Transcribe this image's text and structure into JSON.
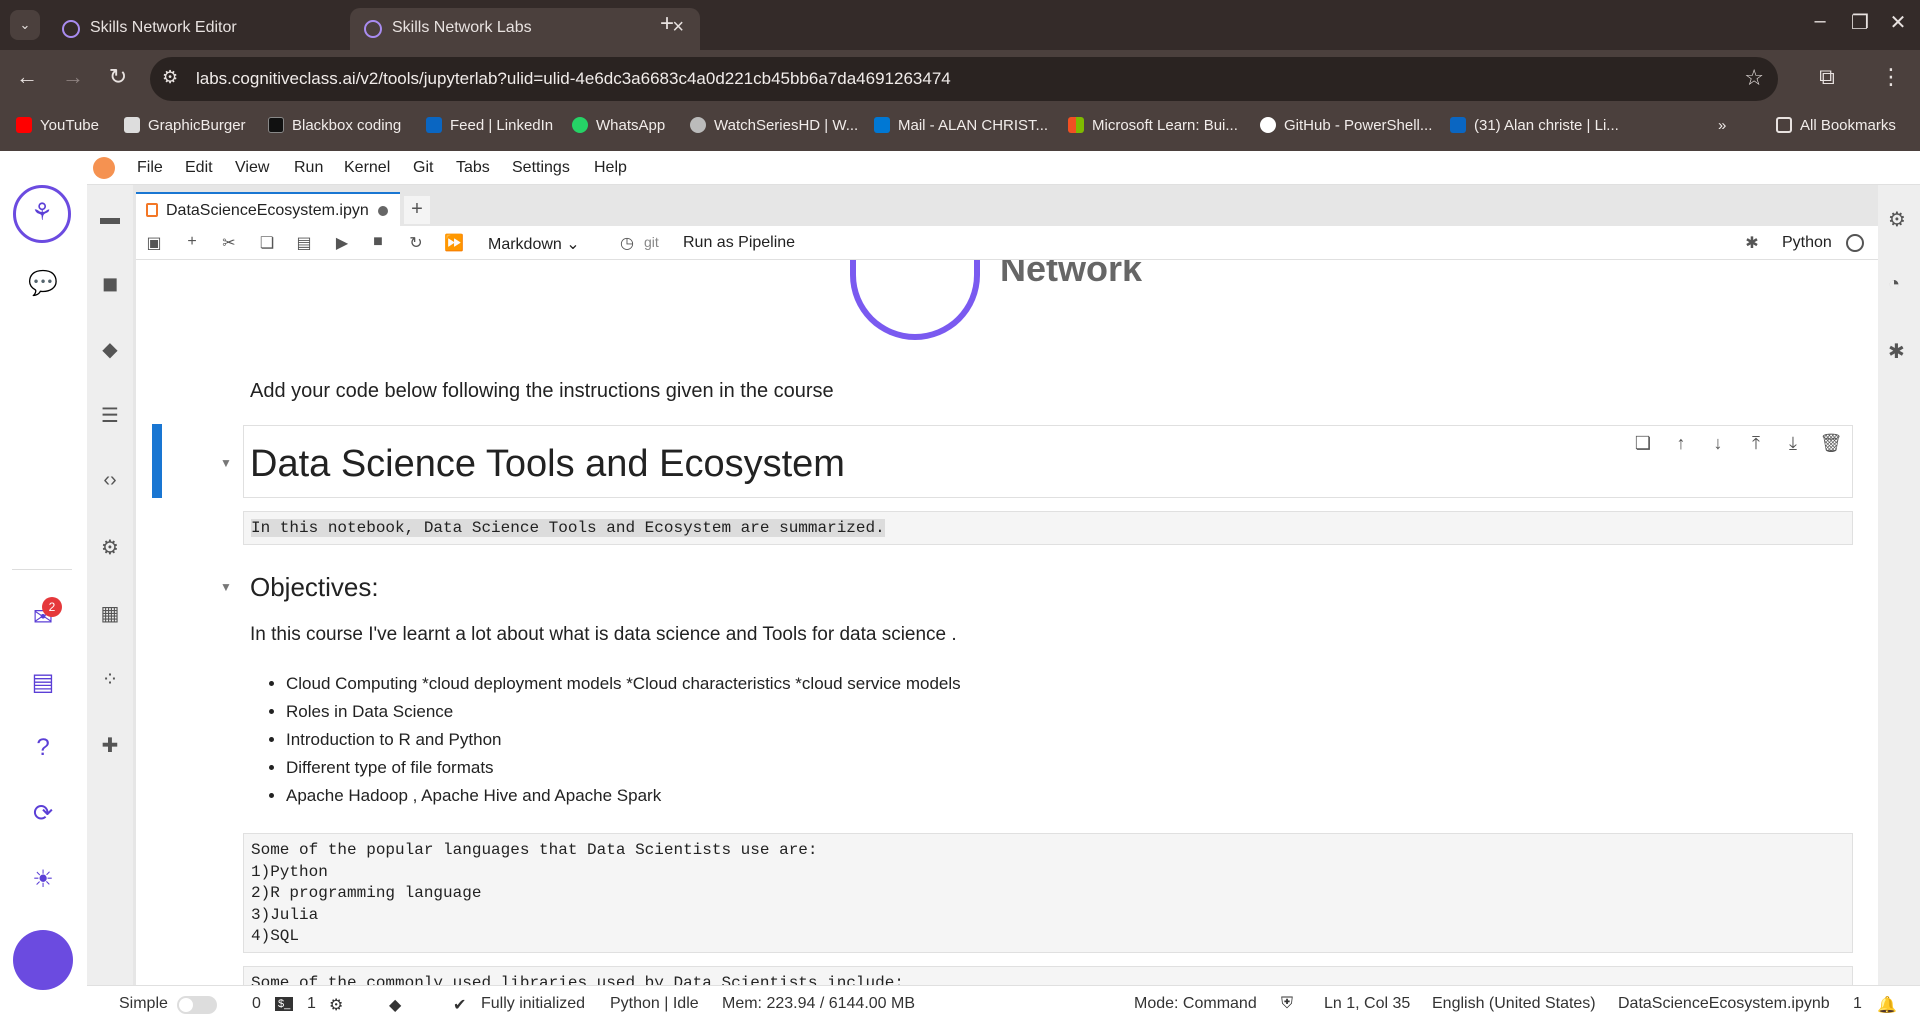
{
  "browser": {
    "tabs": [
      {
        "title": "Skills Network Editor",
        "active": false
      },
      {
        "title": "Skills Network Labs",
        "active": true
      }
    ],
    "url": "labs.cognitiveclass.ai/v2/tools/jupyterlab?ulid=ulid-4e6dc3a6683c4a0d221cb45bb6a7da4691263474",
    "bookmarks": [
      {
        "label": "YouTube",
        "color": "#ff0000"
      },
      {
        "label": "GraphicBurger",
        "color": "#dddddd"
      },
      {
        "label": "Blackbox coding",
        "color": "#111111"
      },
      {
        "label": "Feed | LinkedIn",
        "color": "#0a66c2"
      },
      {
        "label": "WhatsApp",
        "color": "#25d366"
      },
      {
        "label": "WatchSeriesHD | W...",
        "color": "#bbbbbb"
      },
      {
        "label": "Mail - ALAN CHRIST...",
        "color": "#0078d4"
      },
      {
        "label": "Microsoft Learn: Bui...",
        "color": "#f25022"
      },
      {
        "label": "GitHub - PowerShell...",
        "color": "#ffffff"
      },
      {
        "label": "(31) Alan christe | Li...",
        "color": "#0a66c2"
      }
    ],
    "all_bookmarks": "All Bookmarks"
  },
  "jupyter": {
    "menu": [
      "File",
      "Edit",
      "View",
      "Run",
      "Kernel",
      "Git",
      "Tabs",
      "Settings",
      "Help"
    ],
    "doc_tab": "DataScienceEcosystem.ipyn",
    "toolbar": {
      "cell_type": "Markdown",
      "git": "git",
      "pipeline": "Run as Pipeline",
      "kernel": "Python"
    },
    "logo_word": "Network",
    "notebook": {
      "intro": "Add your code below following the instructions given in the course",
      "h1": "Data Science Tools and Ecosystem",
      "summary": "In this notebook, Data Science Tools and Ecosystem are summarized.",
      "h2": "Objectives:",
      "learnt": "In this course I've learnt a lot about what is data science and Tools for data science .",
      "bullets": [
        "Cloud Computing *cloud deployment models *Cloud characteristics *cloud service models",
        "Roles in Data Science",
        "Introduction to R and Python",
        "Different type of file formats",
        "Apache Hadoop , Apache Hive and Apache Spark"
      ],
      "languages_cell": "Some of the popular languages that Data Scientists use are:\n1)Python\n2)R programming language\n3)Julia\n4)SQL",
      "libraries_cell": "Some of the commonly used libraries used by Data Scientists include:"
    },
    "sn_badge": "2",
    "status": {
      "mode_label": "Simple",
      "terminals": "0",
      "kernels": "1",
      "init": "Fully initialized",
      "kernel_state": "Python | Idle",
      "mem": "Mem: 223.94 / 6144.00 MB",
      "mode": "Mode: Command",
      "cursor": "Ln 1, Col 35",
      "lang": "English (United States)",
      "file": "DataScienceEcosystem.ipynb",
      "notif": "1"
    }
  }
}
